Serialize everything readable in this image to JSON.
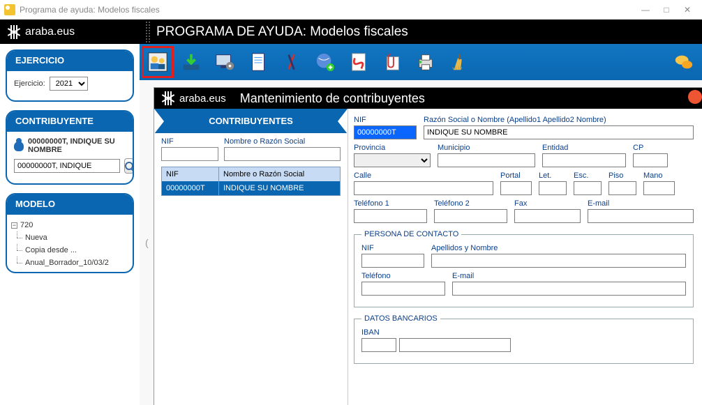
{
  "window": {
    "title": "Programa de ayuda: Modelos fiscales"
  },
  "header": {
    "brand": "araba.eus",
    "app_title": "PROGRAMA DE AYUDA: Modelos fiscales"
  },
  "sidebar": {
    "ejercicio": {
      "title": "EJERCICIO",
      "label": "Ejercicio:",
      "value": "2021"
    },
    "contribuyente": {
      "title": "CONTRIBUYENTE",
      "display": "00000000T, INDIQUE SU NOMBRE",
      "search_value": "00000000T, INDIQUE"
    },
    "modelo": {
      "title": "MODELO",
      "root": "720",
      "children": [
        "Nueva",
        "Copia desde ...",
        "Anual_Borrador_10/03/2"
      ]
    }
  },
  "subwindow": {
    "brand": "araba.eus",
    "title": "Mantenimiento de contribuyentes",
    "left": {
      "header": "CONTRIBUYENTES",
      "nif_label": "NIF",
      "name_label": "Nombre o Razón Social",
      "nif_filter": "",
      "name_filter": "",
      "grid": {
        "col_nif": "NIF",
        "col_name": "Nombre o Razón Social",
        "row_nif": "00000000T",
        "row_name": "INDIQUE SU NOMBRE"
      }
    },
    "form": {
      "nif_label": "NIF",
      "nif_value": "00000000T",
      "razon_label": "Razón Social o Nombre (Apellido1 Apellido2 Nombre)",
      "razon_value": "INDIQUE SU NOMBRE",
      "provincia_label": "Provincia",
      "municipio_label": "Municipio",
      "entidad_label": "Entidad",
      "cp_label": "CP",
      "calle_label": "Calle",
      "portal_label": "Portal",
      "let_label": "Let.",
      "esc_label": "Esc.",
      "piso_label": "Piso",
      "mano_label": "Mano",
      "tel1_label": "Teléfono 1",
      "tel2_label": "Teléfono 2",
      "fax_label": "Fax",
      "email_label": "E-mail",
      "contacto_legend": "PERSONA DE CONTACTO",
      "c_nif_label": "NIF",
      "c_ape_label": "Apellidos y Nombre",
      "c_tel_label": "Teléfono",
      "c_email_label": "E-mail",
      "banco_legend": "DATOS BANCARIOS",
      "iban_label": "IBAN"
    }
  }
}
